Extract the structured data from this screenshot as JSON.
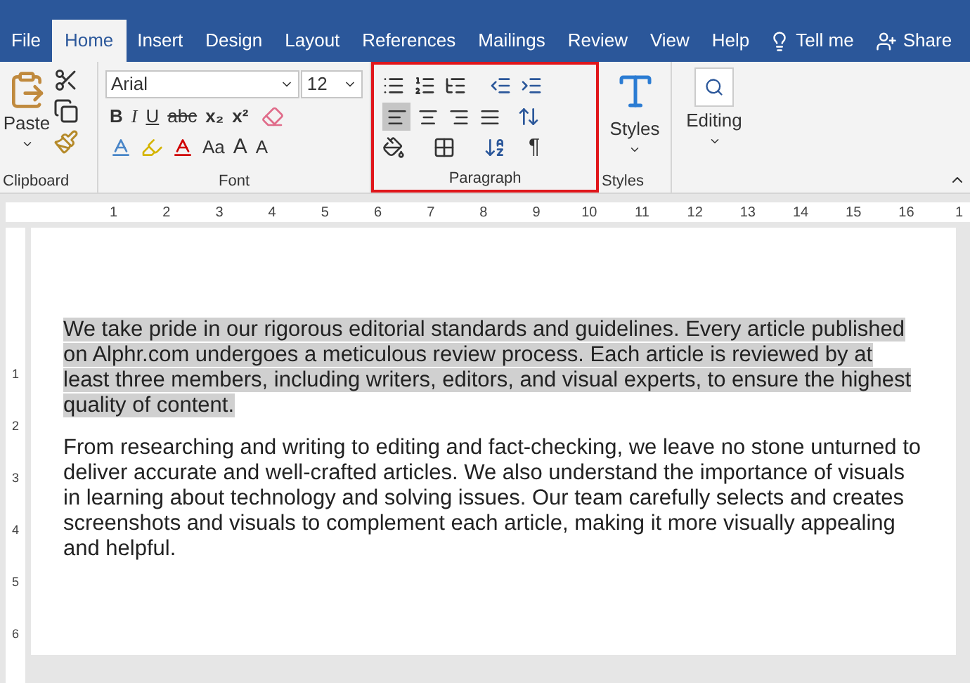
{
  "tabs": [
    {
      "label": "File",
      "selected": false
    },
    {
      "label": "Home",
      "selected": true
    },
    {
      "label": "Insert",
      "selected": false
    },
    {
      "label": "Design",
      "selected": false
    },
    {
      "label": "Layout",
      "selected": false
    },
    {
      "label": "References",
      "selected": false
    },
    {
      "label": "Mailings",
      "selected": false
    },
    {
      "label": "Review",
      "selected": false
    },
    {
      "label": "View",
      "selected": false
    },
    {
      "label": "Help",
      "selected": false
    }
  ],
  "tell_me": "Tell me",
  "share": "Share",
  "clipboard": {
    "paste": "Paste",
    "label": "Clipboard"
  },
  "font": {
    "name": "Arial",
    "size": "12",
    "bold": "B",
    "italic": "I",
    "underline": "U",
    "strike": "abc",
    "subscript": "x₂",
    "superscript": "x²",
    "case": "Aa",
    "grow": "A",
    "shrink": "A",
    "label": "Font"
  },
  "paragraph": {
    "label": "Paragraph",
    "highlighted": true,
    "pilcrow": "¶",
    "align": [
      {
        "selected": true
      },
      {
        "selected": false
      },
      {
        "selected": false
      },
      {
        "selected": false
      }
    ]
  },
  "styles": {
    "button": "Styles",
    "label": "Styles"
  },
  "editing": {
    "button": "Editing"
  },
  "ruler": {
    "labels": [
      "1",
      "2",
      "3",
      "4",
      "5",
      "6",
      "7",
      "8",
      "9",
      "10",
      "11",
      "12",
      "13",
      "14",
      "15",
      "16",
      "1"
    ]
  },
  "vertical_ruler": {
    "labels": [
      "1",
      "2",
      "3",
      "4",
      "5",
      "6"
    ]
  },
  "document": {
    "paragraphs": [
      {
        "text": "We take pride in our rigorous editorial standards and guidelines. Every article published on Alphr.com undergoes a meticulous review process. Each article is reviewed by at least three members, including writers, editors, and visual experts, to ensure the highest quality of content.",
        "selected": true
      },
      {
        "text": "From researching and writing to editing and fact-checking, we leave no stone unturned to deliver accurate and well-crafted articles. We also understand the importance of visuals in learning about technology and solving issues. Our team carefully selects and creates screenshots and visuals to complement each article, making it more visually appealing and helpful.",
        "selected": false
      }
    ]
  }
}
